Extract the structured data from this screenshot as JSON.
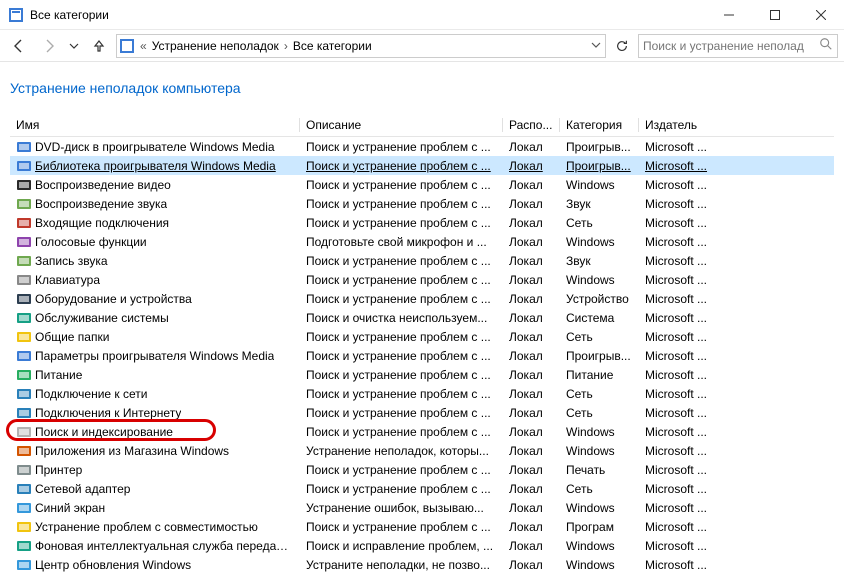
{
  "window": {
    "title": "Все категории"
  },
  "breadcrumb": {
    "root_glyph": "«",
    "part1": "Устранение неполадок",
    "part2": "Все категории"
  },
  "search": {
    "placeholder": "Поиск и устранение неполад"
  },
  "page": {
    "title": "Устранение неполадок компьютера"
  },
  "columns": {
    "name": "Имя",
    "desc": "Описание",
    "loc": "Распо...",
    "cat": "Категория",
    "pub": "Издатель"
  },
  "items": [
    {
      "name": "DVD-диск в проигрывателе Windows Media",
      "desc": "Поиск и устранение проблем с ...",
      "loc": "Локал",
      "cat": "Проигрыв...",
      "pub": "Microsoft ...",
      "ic": "#3a7bd5"
    },
    {
      "name": "Библиотека проигрывателя Windows Media",
      "desc": "Поиск и устранение проблем с ...",
      "loc": "Локал",
      "cat": "Проигрыв...",
      "pub": "Microsoft ...",
      "ic": "#3a7bd5",
      "selected": true
    },
    {
      "name": "Воспроизведение видео",
      "desc": "Поиск и устранение проблем с ...",
      "loc": "Локал",
      "cat": "Windows",
      "pub": "Microsoft ...",
      "ic": "#2a2a2a"
    },
    {
      "name": "Воспроизведение звука",
      "desc": "Поиск и устранение проблем с ...",
      "loc": "Локал",
      "cat": "Звук",
      "pub": "Microsoft ...",
      "ic": "#6fa84f"
    },
    {
      "name": "Входящие подключения",
      "desc": "Поиск и устранение проблем с ...",
      "loc": "Локал",
      "cat": "Сеть",
      "pub": "Microsoft ...",
      "ic": "#c0392b"
    },
    {
      "name": "Голосовые функции",
      "desc": "Подготовьте свой микрофон и ...",
      "loc": "Локал",
      "cat": "Windows",
      "pub": "Microsoft ...",
      "ic": "#8e44ad"
    },
    {
      "name": "Запись звука",
      "desc": "Поиск и устранение проблем с ...",
      "loc": "Локал",
      "cat": "Звук",
      "pub": "Microsoft ...",
      "ic": "#6fa84f"
    },
    {
      "name": "Клавиатура",
      "desc": "Поиск и устранение проблем с ...",
      "loc": "Локал",
      "cat": "Windows",
      "pub": "Microsoft ...",
      "ic": "#888"
    },
    {
      "name": "Оборудование и устройства",
      "desc": "Поиск и устранение проблем с ...",
      "loc": "Локал",
      "cat": "Устройство",
      "pub": "Microsoft ...",
      "ic": "#2c3e50"
    },
    {
      "name": "Обслуживание системы",
      "desc": "Поиск и очистка неиспользуем...",
      "loc": "Локал",
      "cat": "Система",
      "pub": "Microsoft ...",
      "ic": "#16a085"
    },
    {
      "name": "Общие папки",
      "desc": "Поиск и устранение проблем с ...",
      "loc": "Локал",
      "cat": "Сеть",
      "pub": "Microsoft ...",
      "ic": "#f1c40f"
    },
    {
      "name": "Параметры проигрывателя Windows Media",
      "desc": "Поиск и устранение проблем с ...",
      "loc": "Локал",
      "cat": "Проигрыв...",
      "pub": "Microsoft ...",
      "ic": "#3a7bd5"
    },
    {
      "name": "Питание",
      "desc": "Поиск и устранение проблем с ...",
      "loc": "Локал",
      "cat": "Питание",
      "pub": "Microsoft ...",
      "ic": "#27ae60"
    },
    {
      "name": "Подключение к сети",
      "desc": "Поиск и устранение проблем с ...",
      "loc": "Локал",
      "cat": "Сеть",
      "pub": "Microsoft ...",
      "ic": "#2980b9"
    },
    {
      "name": "Подключения к Интернету",
      "desc": "Поиск и устранение проблем с ...",
      "loc": "Локал",
      "cat": "Сеть",
      "pub": "Microsoft ...",
      "ic": "#2980b9"
    },
    {
      "name": "Поиск и индексирование",
      "desc": "Поиск и устранение проблем с ...",
      "loc": "Локал",
      "cat": "Windows",
      "pub": "Microsoft ...",
      "ic": "#b3b3b3",
      "highlighted": true
    },
    {
      "name": "Приложения из Магазина Windows",
      "desc": "Устранение неполадок, которы...",
      "loc": "Локал",
      "cat": "Windows",
      "pub": "Microsoft ...",
      "ic": "#d35400"
    },
    {
      "name": "Принтер",
      "desc": "Поиск и устранение проблем с ...",
      "loc": "Локал",
      "cat": "Печать",
      "pub": "Microsoft ...",
      "ic": "#7f8c8d"
    },
    {
      "name": "Сетевой адаптер",
      "desc": "Поиск и устранение проблем с ...",
      "loc": "Локал",
      "cat": "Сеть",
      "pub": "Microsoft ...",
      "ic": "#2980b9"
    },
    {
      "name": "Синий экран",
      "desc": "Устранение ошибок, вызываю...",
      "loc": "Локал",
      "cat": "Windows",
      "pub": "Microsoft ...",
      "ic": "#3498db"
    },
    {
      "name": "Устранение проблем с совместимостью",
      "desc": "Поиск и устранение проблем с ...",
      "loc": "Локал",
      "cat": "Програм",
      "pub": "Microsoft ...",
      "ic": "#f1c40f"
    },
    {
      "name": "Фоновая интеллектуальная служба передачи (...",
      "desc": "Поиск и исправление проблем, ...",
      "loc": "Локал",
      "cat": "Windows",
      "pub": "Microsoft ...",
      "ic": "#16a085"
    },
    {
      "name": "Центр обновления Windows",
      "desc": "Устраните неполадки, не позво...",
      "loc": "Локал",
      "cat": "Windows",
      "pub": "Microsoft ...",
      "ic": "#3498db"
    }
  ]
}
